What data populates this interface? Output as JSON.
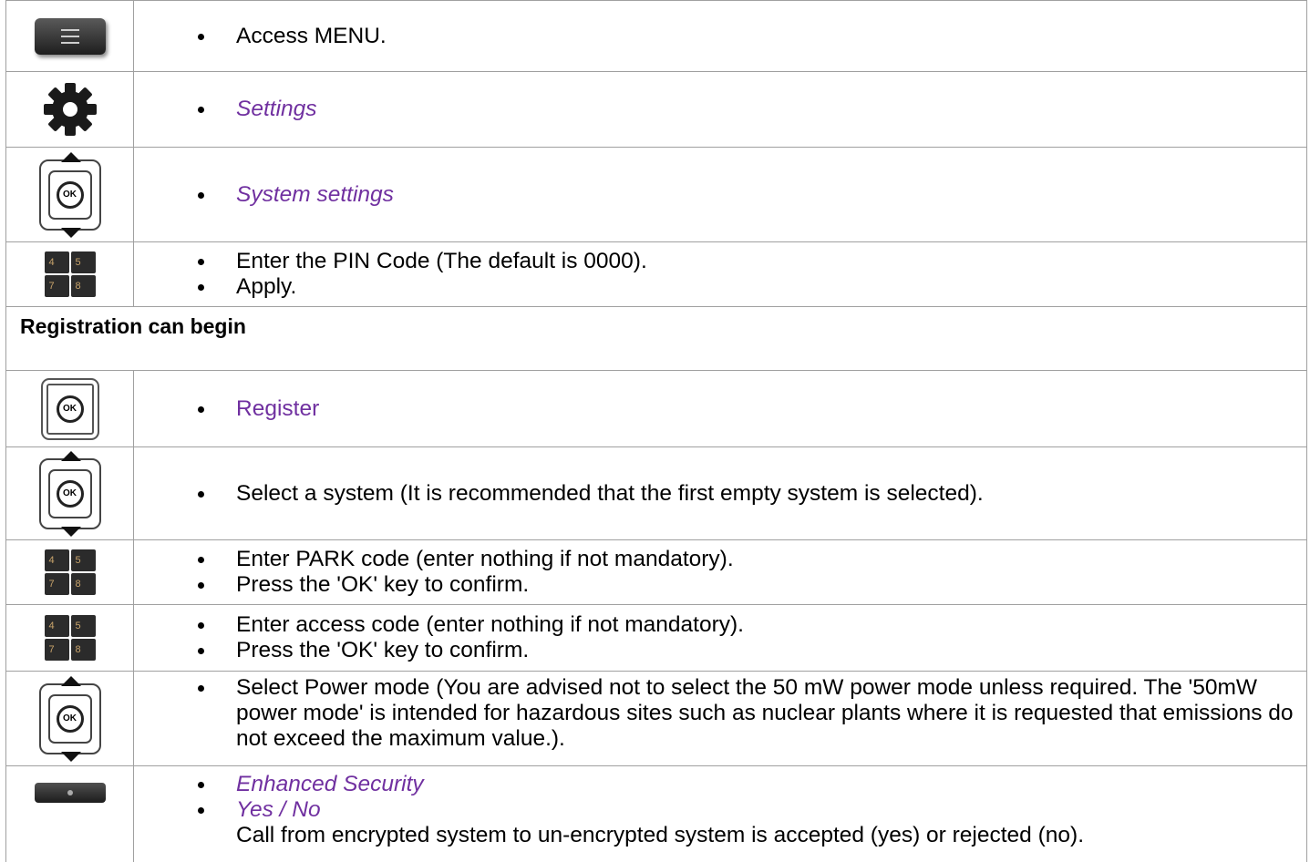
{
  "rows": [
    {
      "icon": "menu-key-icon",
      "items": [
        {
          "text": "Access MENU."
        }
      ]
    },
    {
      "icon": "gear-icon",
      "items": [
        {
          "text": "Settings"
        }
      ]
    },
    {
      "icon": "navigator-ok-icon",
      "items": [
        {
          "text": "System settings"
        }
      ]
    },
    {
      "icon": "keypad-icon",
      "items": [
        {
          "text": "Enter the PIN Code (The default is 0000)."
        },
        {
          "text": "Apply."
        }
      ]
    }
  ],
  "heading": "Registration can begin",
  "rows2": [
    {
      "icon": "ok-key-icon",
      "items": [
        {
          "text": "Register"
        }
      ]
    },
    {
      "icon": "navigator-ok-icon",
      "items": [
        {
          "text": "Select a system (It is recommended that the first empty system is selected)."
        }
      ]
    },
    {
      "icon": "keypad-icon",
      "items": [
        {
          "text": "Enter PARK code (enter nothing if not mandatory)."
        },
        {
          "text": "Press the 'OK' key to confirm."
        }
      ]
    },
    {
      "icon": "keypad-icon",
      "items": [
        {
          "text": "Enter access code (enter nothing if not mandatory)."
        },
        {
          "text": "Press the 'OK' key to confirm."
        }
      ]
    },
    {
      "icon": "navigator-ok-icon",
      "items": [
        {
          "text": "Select Power mode (You are advised not to select the 50 mW power mode unless required. The '50mW power mode' is intended for hazardous sites such as nuclear plants where it is requested that emissions do not exceed the maximum value.)."
        }
      ]
    },
    {
      "icon": "softkey-icon",
      "items": [
        {
          "text": "Enhanced Security"
        },
        {
          "text": "Yes / No"
        }
      ],
      "note": "Call from encrypted system to un-encrypted system is accepted (yes) or rejected (no)."
    }
  ],
  "keypad_labels": [
    "4",
    "5",
    "7",
    "8"
  ],
  "ok_label": "OK",
  "colors": {
    "link_purple": "#7030a0",
    "border": "#a0a0a0"
  }
}
